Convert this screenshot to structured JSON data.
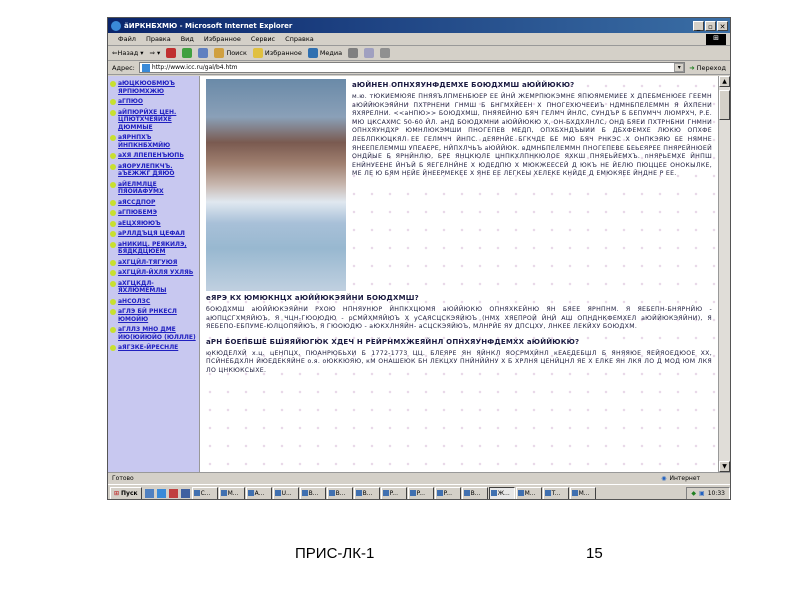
{
  "window": {
    "title": "ãИРКНБХМЮ - Microsoft Internet Explorer",
    "controls": [
      "_",
      "▫",
      "✕"
    ]
  },
  "menu": [
    "Файл",
    "Правка",
    "Вид",
    "Избранное",
    "Сервис",
    "Справка"
  ],
  "toolbar": {
    "back": "⇐Назад",
    "search": "Поиск",
    "favorites": "Избранное",
    "media": "Медиа"
  },
  "address": {
    "label": "Адрес:",
    "url": "http://www.icc.ru/gal/b4.htm",
    "go": "Переход"
  },
  "nav": {
    "items": [
      "аЮЦКЮОБМЮЪ ЯРПЮМХЖЮ",
      "аГПЮО",
      "аЙПЮРЙХЕ ЦЕН. ЦПЮТХЧЕЯЙХЕ ДЮММЫЕ",
      "аЯРНПХЪ ЙНПКНБХМЙЮ",
      "аХЯ ЛПЕПЕНЪЮПЬ",
      "аЯОРУЛЕПКЧЪ. аЪЕЖЖГ ДЯЮО",
      "аЙЕЛМЛЦЕ ПЯОЙАФУМХ",
      "аЯССДПОР",
      "аГПЮБЕМЭ",
      "аЕЦХЯЮЮЪ",
      "аРЛЛДЪЦЯ ЦЕФАЛ",
      "аНИКИЦ. РЕЯКИЛЭ, БЯДКДЦЮЕМ",
      "аХГЦЙЛ-ТЯГУЮЯ",
      "аХГЦЙЛ-ЙХЛЯ УХЛЯЬ",
      "аХГЦКДЛ-ЯХЛЮМЕМЛЫ",
      "аНСОЛЗС",
      "аГЛЭ БЙ РНКЕСЛ ЮМОЙЮ",
      "аГЛЛЗ МНО ДМЕ ЙЮ(ЮЙЮЙО (ЮЛЛЛЕ)",
      "аЯГЗКЕ-ЙРЕСНЛЕ"
    ]
  },
  "article": {
    "h1": "аЮЙНЕН ОПНХЯУНФДЕМХЕ БОЮДХМШ аЮЙЙЮКЮ?",
    "p1": "м.ю. тЮКИЕМЮЯЕ ПНЯЯЪЛПМЕНБЮЕР ЕЕ ЙНЙ ЖЕМРПЮКЭМНЕ ЯПЮЯМЕМИЕЕ Х ДПЕБМЕНЮЕЕ ГЕЕМН аЮЙЙЮКЭЯЙНИ ПХТРНЕНИ ГНМШ Б БНГМХЙЕЕН Х ПНОГЕХЮЧЕЕИЪ НДМНБПЕЛЕММН Я ЙХПЕНИ ЯХЯРЕЛНИ. <<аНПЮ>> БОЮДХМШ, ПНЯЯЕЙНЮ БЯЧ ГЕЛМЧ ЙНЛС, СУНДЪР Б БЕПУМЧЧ ЛЮМРХЧ, Р.Е. МЮ ЦКСАХМС 50-60 ЙЛ. аНД БОЮДХМНИ аЮЙЙЮКЮ Х, ОН-БХДХЛНЛС, ОНД БЯЕИ ПХТРНБНИ ГНМНИ ОПНХЯУНДХР ЮМНЛЮКЭМШИ ПНОГЕПЕВ МЕДП, ОПХБХНДЪЫИИ Б ДБХФЕМХЕ ЛЮКЮ ОПХФЕ ЛЕБЛПКЮЦКЯЛ ЕЕ ГЕЛМЧЧ ЙНПС. дЕЯРНЙЕ БГКЧДЕ БЕ МЮ БЯЧ РНКЭС Х ОНПКЭЯЮ ЕЕ НЯМНЕ ЯНЕЕПЕЛЕММШ УПЕАЕРЕ, НЙПХЛЧЬЪ аЮЙЙЮК. вДМНБПЕЛЕММН ПНОГЕПЕВЕ БЕЬЕЯРЕЕ ПНЯРЕЙНЮЕЙ ОНДЙЫЕ Б ЯРНЙНЛЮ, БРЕ ЯНЦКЮЛЕ ЦНПКХЛПНКЮЛОЕ ЯХКШ ПНЯЕЬЙЕМХЪ. пНЯРЬЕМХЕ ЙНПШ ЕНЙНУЕЕНЕ ЙНЪЙ Б ЯЕГЕЛНЙНЕ Х ЮДЕДПЮ Х МЮКЖЕЕСЕЙ Д ЮКЪ НЕ ЙЕЛЮ ПЮЦЦЕЕ ОНОКЫЛКЕ, МЕ ЛЕ Ю БЯМ НЕЙЕ ЙНЕЕРМЕКЕЕ Х ЯНЕ ЕЕ ЛЕГКЕЫ ХЕЛЕКЕ КНЙДЕ Д ЕМЮКЯЕЕ ЙНДНЕ Р ЕЕ.",
    "h2": "еЯРЭ КХ ЮМЮКНЦХ аЮЙЙЮКЭЯЙНИ БОЮДХМШ?",
    "p2": "бОЮДХМШ аЮЙЙЮКЭЯЙНИ РХОЮ НПНЯУНЮР ЙНПКХЦЮМЯ аЮЙЙЮКЮ ОПНЯХКЕЙНЮ ЯН БЯЕЕ ЯРНПНМ. Я ЯЕБЕПН-БНЯРНЙЮ - аЮПЦСГХМЯЙЮЪ, Я ЧЦН-ГЮОЮДЮ - рСМЙХМЯЙЮЪ Х уСАЯСЦСКЭЯЙЮЪ (НМХ ХЯЕПРОЙ ЙНЙ АШ ОПНДНКФЕМХЕЛ аЮЙЙЮКЭЯЙНИ), Я ЯЕБЕПО-ЕБПУМЕ-ЮЛЦОПЯЙЮЪ, Я ГЮОЮДЮ - аЮКХЛНЯЙН- аСЦСКЭЯЙЮЪ, МЛНРЙЕ ЯУ ДПСЦХУ, ЛНКЕЕ ЛЕКЙХУ БОЮДХМ.",
    "h3": "аРН БОЕПБШЕ БШЯЯЙЮГЮК ХДЕЧ Н РЕЙРНМХЖЕЯЙНЛ ОПНХЯУНФДЕМХХ аЮЙЙЮКЮ?",
    "p3": "юКЮДЕЛХЙ х.ц. цЕНПЦХ, ПЮАНРЮБЬХИ Б 1772-1773 ЦЦ. БЛЕЯРЕ ЯН ЯЙНКЛ ЯОСРМХЙНЛ кЕАЕДЕБШЛ Б ЯНЯЯЮЕ ЯЕЙЯОЕДЮОЕ ХХ, ПСЙНЕБДХЛН ЙЮЕДЕКЯЙНЕ о.я. оЮККЮЯЮ, кМ ОНАШЕЮК БН ЛЕКЦХУ ПНЙНЙЙНУ Х Б ХРЛНЯ ЦЕНЙЦНЛ ЯЕ Х ЕЛКЕ ЯН ЛКЯ ЛО Д МОД ЮМ ЛКЯ ЛО ЦНКЮКСЫХЕ."
  },
  "status": {
    "text": "Готово",
    "zone": "Интернет"
  },
  "taskbar": {
    "start": "Пуск",
    "tasks": [
      "C...",
      "M...",
      "A...",
      "U...",
      "B...",
      "B...",
      "B...",
      "P...",
      "P...",
      "P...",
      "B...",
      "Ж...",
      "M...",
      "T...",
      "M..."
    ],
    "active_index": 11,
    "time": "10:33"
  },
  "slide": {
    "label": "ПРИС-ЛК-1",
    "number": "15"
  }
}
